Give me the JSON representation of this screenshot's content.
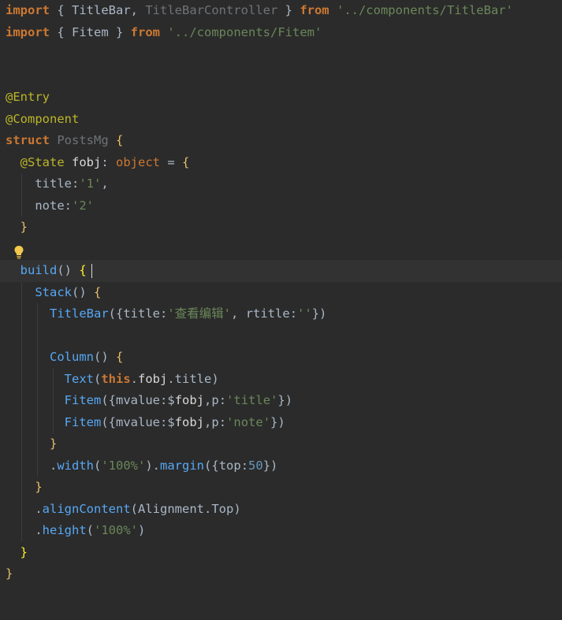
{
  "lines": [
    {
      "tokens": [
        [
          "kw",
          "import "
        ],
        [
          "punc",
          "{ "
        ],
        [
          "cls",
          "TitleBar"
        ],
        [
          "punc",
          ", "
        ],
        [
          "cls-dim",
          "TitleBarController"
        ],
        [
          "punc",
          " } "
        ],
        [
          "kw",
          "from "
        ],
        [
          "str",
          "'../components/TitleBar'"
        ]
      ]
    },
    {
      "tokens": [
        [
          "kw",
          "import "
        ],
        [
          "punc",
          "{ "
        ],
        [
          "cls",
          "Fitem"
        ],
        [
          "punc",
          " } "
        ],
        [
          "kw",
          "from "
        ],
        [
          "str",
          "'../components/Fitem'"
        ]
      ]
    },
    {
      "tokens": []
    },
    {
      "tokens": []
    },
    {
      "tokens": [
        [
          "ann",
          "@Entry"
        ]
      ]
    },
    {
      "tokens": [
        [
          "ann",
          "@Component"
        ]
      ]
    },
    {
      "tokens": [
        [
          "kw",
          "struct "
        ],
        [
          "cls-dim",
          "PostsMg "
        ],
        [
          "brace",
          "{"
        ]
      ]
    },
    {
      "tokens": [
        [
          "punc",
          "  "
        ],
        [
          "ann",
          "@State "
        ],
        [
          "field",
          "fobj"
        ],
        [
          "punc",
          ": "
        ],
        [
          "op",
          "object "
        ],
        [
          "punc",
          "= "
        ],
        [
          "brace",
          "{"
        ]
      ]
    },
    {
      "tokens": [
        [
          "punc",
          "    "
        ],
        [
          "prop",
          "title"
        ],
        [
          "punc",
          ":"
        ],
        [
          "str",
          "'1'"
        ],
        [
          "punc",
          ","
        ]
      ]
    },
    {
      "tokens": [
        [
          "punc",
          "    "
        ],
        [
          "prop",
          "note"
        ],
        [
          "punc",
          ":"
        ],
        [
          "str",
          "'2'"
        ]
      ]
    },
    {
      "tokens": [
        [
          "punc",
          "  "
        ],
        [
          "brace",
          "}"
        ]
      ]
    },
    {
      "tokens": []
    },
    {
      "tokens": [
        [
          "punc",
          "  "
        ],
        [
          "method",
          "build"
        ],
        [
          "punc",
          "() "
        ],
        [
          "brace-hl",
          "{"
        ]
      ],
      "current": true
    },
    {
      "tokens": [
        [
          "punc",
          "    "
        ],
        [
          "comp",
          "Stack"
        ],
        [
          "punc",
          "() "
        ],
        [
          "brace",
          "{"
        ]
      ]
    },
    {
      "tokens": [
        [
          "punc",
          "      "
        ],
        [
          "comp",
          "TitleBar"
        ],
        [
          "punc",
          "({"
        ],
        [
          "prop",
          "title"
        ],
        [
          "punc",
          ":"
        ],
        [
          "str",
          "'查看编辑'"
        ],
        [
          "punc",
          ", "
        ],
        [
          "prop",
          "rtitle"
        ],
        [
          "punc",
          ":"
        ],
        [
          "str",
          "''"
        ],
        [
          "punc",
          "})"
        ]
      ]
    },
    {
      "tokens": []
    },
    {
      "tokens": [
        [
          "punc",
          "      "
        ],
        [
          "comp",
          "Column"
        ],
        [
          "punc",
          "() "
        ],
        [
          "brace",
          "{"
        ]
      ]
    },
    {
      "tokens": [
        [
          "punc",
          "        "
        ],
        [
          "comp",
          "Text"
        ],
        [
          "punc",
          "("
        ],
        [
          "this",
          "this"
        ],
        [
          "punc",
          "."
        ],
        [
          "field",
          "fobj"
        ],
        [
          "punc",
          "."
        ],
        [
          "prop",
          "title"
        ],
        [
          "punc",
          ")"
        ]
      ]
    },
    {
      "tokens": [
        [
          "punc",
          "        "
        ],
        [
          "comp",
          "Fitem"
        ],
        [
          "punc",
          "({"
        ],
        [
          "prop",
          "mvalue"
        ],
        [
          "punc",
          ":"
        ],
        [
          "punc",
          "$"
        ],
        [
          "field",
          "fobj"
        ],
        [
          "punc",
          ","
        ],
        [
          "prop",
          "p"
        ],
        [
          "punc",
          ":"
        ],
        [
          "str",
          "'title'"
        ],
        [
          "punc",
          "})"
        ]
      ]
    },
    {
      "tokens": [
        [
          "punc",
          "        "
        ],
        [
          "comp",
          "Fitem"
        ],
        [
          "punc",
          "({"
        ],
        [
          "prop",
          "mvalue"
        ],
        [
          "punc",
          ":"
        ],
        [
          "punc",
          "$"
        ],
        [
          "field",
          "fobj"
        ],
        [
          "punc",
          ","
        ],
        [
          "prop",
          "p"
        ],
        [
          "punc",
          ":"
        ],
        [
          "str",
          "'note'"
        ],
        [
          "punc",
          "})"
        ]
      ]
    },
    {
      "tokens": [
        [
          "punc",
          "      "
        ],
        [
          "brace",
          "}"
        ]
      ]
    },
    {
      "tokens": [
        [
          "punc",
          "      ."
        ],
        [
          "method",
          "width"
        ],
        [
          "punc",
          "("
        ],
        [
          "str",
          "'100%'"
        ],
        [
          "punc",
          ")."
        ],
        [
          "method",
          "margin"
        ],
        [
          "punc",
          "({"
        ],
        [
          "prop",
          "top"
        ],
        [
          "punc",
          ":"
        ],
        [
          "num",
          "50"
        ],
        [
          "punc",
          "})"
        ]
      ]
    },
    {
      "tokens": [
        [
          "punc",
          "    "
        ],
        [
          "brace",
          "}"
        ]
      ]
    },
    {
      "tokens": [
        [
          "punc",
          "    ."
        ],
        [
          "method",
          "alignContent"
        ],
        [
          "punc",
          "("
        ],
        [
          "cls",
          "Alignment"
        ],
        [
          "punc",
          "."
        ],
        [
          "prop",
          "Top"
        ],
        [
          "punc",
          ")"
        ]
      ]
    },
    {
      "tokens": [
        [
          "punc",
          "    ."
        ],
        [
          "method",
          "height"
        ],
        [
          "punc",
          "("
        ],
        [
          "str",
          "'100%'"
        ],
        [
          "punc",
          ")"
        ]
      ]
    },
    {
      "tokens": [
        [
          "punc",
          "  "
        ],
        [
          "brace-hl",
          "}"
        ]
      ]
    },
    {
      "tokens": [
        [
          "brace",
          "}"
        ]
      ]
    }
  ]
}
